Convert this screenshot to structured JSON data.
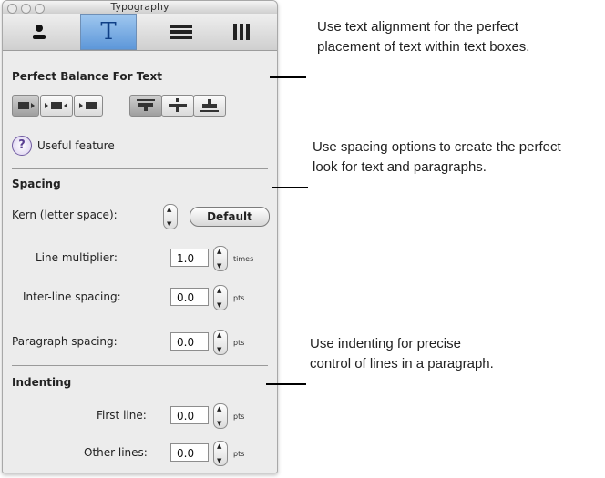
{
  "window": {
    "title": "Typography"
  },
  "tabs": [
    {
      "icon": "person-icon"
    },
    {
      "icon": "text-icon",
      "label": "T"
    },
    {
      "icon": "lines-icon"
    },
    {
      "icon": "columns-icon"
    }
  ],
  "sections": {
    "balance": {
      "title": "Perfect Balance For Text",
      "help_label": "Useful feature"
    },
    "spacing": {
      "title": "Spacing",
      "kern_label": "Kern (letter space):",
      "default_button": "Default",
      "line_multiplier": {
        "label": "Line multiplier:",
        "value": "1.0",
        "unit": "times"
      },
      "interline": {
        "label": "Inter-line spacing:",
        "value": "0.0",
        "unit": "pts"
      },
      "paragraph": {
        "label": "Paragraph spacing:",
        "value": "0.0",
        "unit": "pts"
      }
    },
    "indenting": {
      "title": "Indenting",
      "first_line": {
        "label": "First line:",
        "value": "0.0",
        "unit": "pts"
      },
      "other_lines": {
        "label": "Other lines:",
        "value": "0.0",
        "unit": "pts"
      }
    }
  },
  "callouts": [
    {
      "line1": "Use text alignment for the perfect",
      "line2": "placement of text within text boxes."
    },
    {
      "line1": "Use spacing options to create the perfect",
      "line2": "look for text and paragraphs."
    },
    {
      "line1": "Use indenting for precise",
      "line2": "control of lines in a paragraph."
    }
  ]
}
